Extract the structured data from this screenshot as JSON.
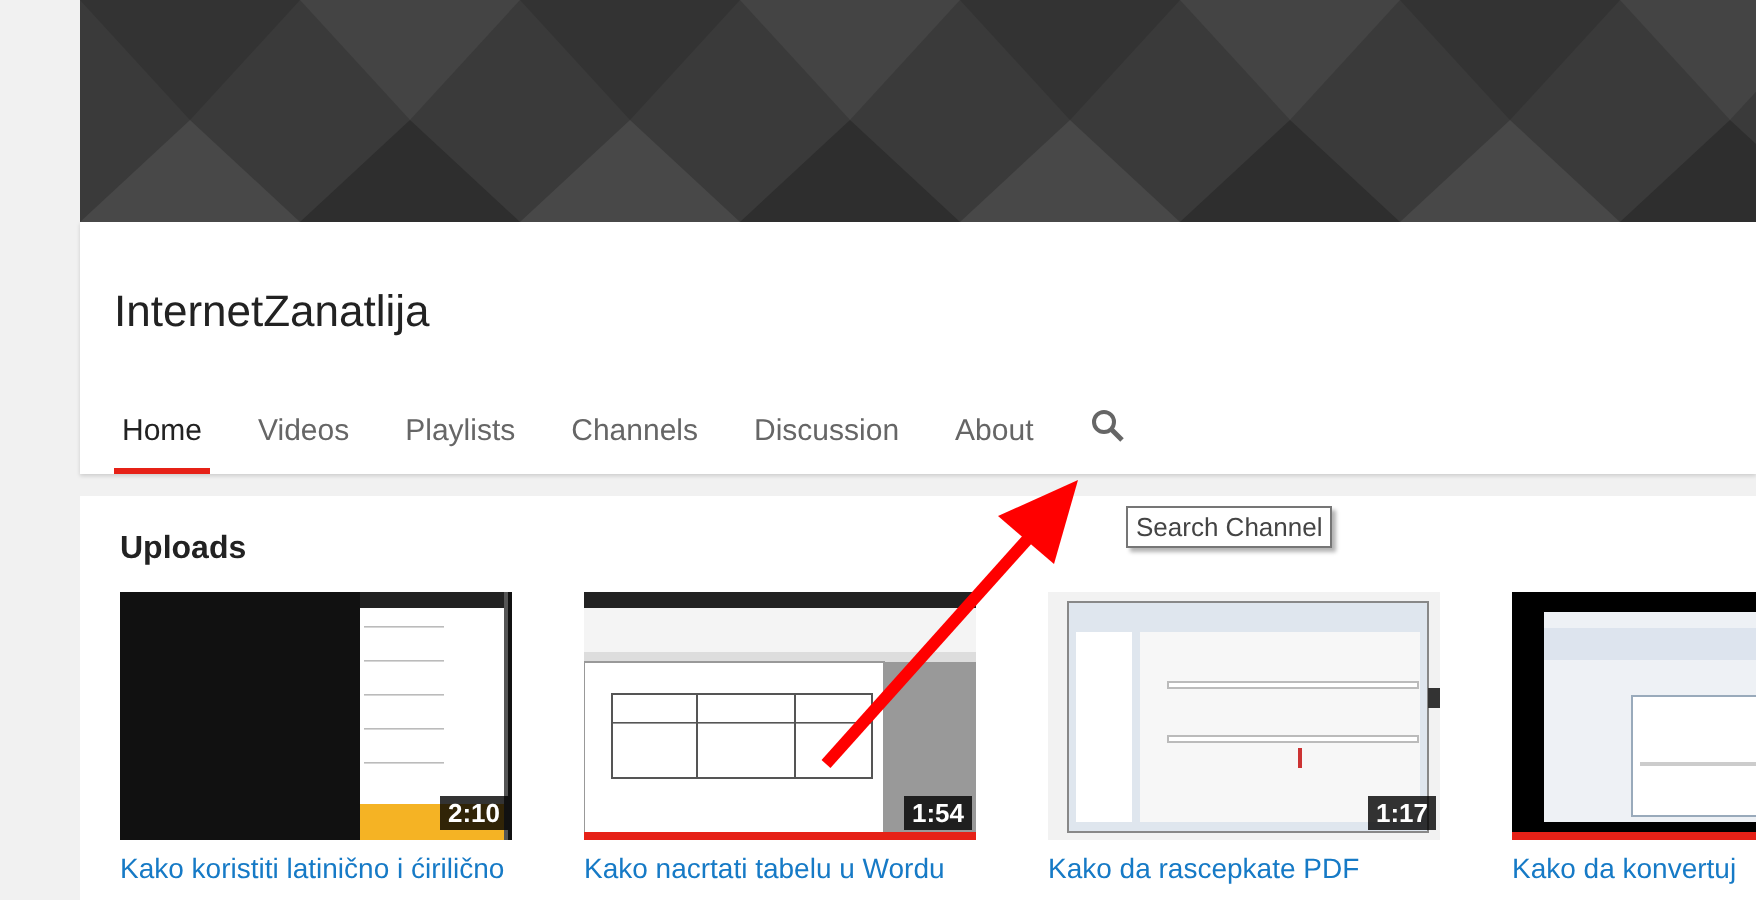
{
  "channel": {
    "name": "InternetZanatlija"
  },
  "tabs": [
    {
      "label": "Home",
      "selected": true
    },
    {
      "label": "Videos",
      "selected": false
    },
    {
      "label": "Playlists",
      "selected": false
    },
    {
      "label": "Channels",
      "selected": false
    },
    {
      "label": "Discussion",
      "selected": false
    },
    {
      "label": "About",
      "selected": false
    }
  ],
  "tooltip": "Search Channel",
  "section": {
    "title": "Uploads"
  },
  "videos": [
    {
      "title": "Kako koristiti latinično i ćirilično",
      "duration": "2:10",
      "kind": "phone",
      "watched": false
    },
    {
      "title": "Kako nacrtati tabelu u Wordu",
      "duration": "1:54",
      "kind": "word",
      "watched": true
    },
    {
      "title": "Kako da rascepkate PDF",
      "duration": "1:17",
      "kind": "dialog",
      "watched": false
    },
    {
      "title": "Kako da konvertuj",
      "kind": "window",
      "watched": true
    }
  ]
}
